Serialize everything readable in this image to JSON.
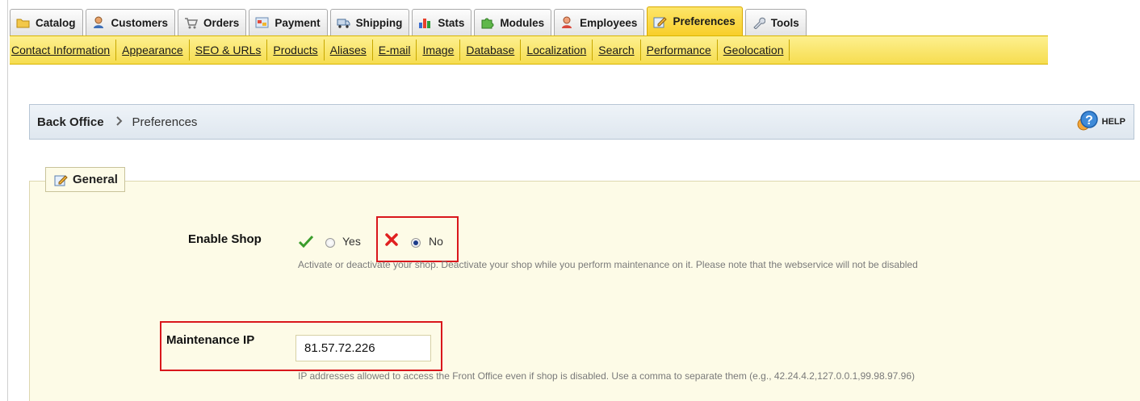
{
  "tabs": [
    {
      "label": "Catalog",
      "icon": "folder-icon"
    },
    {
      "label": "Customers",
      "icon": "customer-icon"
    },
    {
      "label": "Orders",
      "icon": "cart-icon"
    },
    {
      "label": "Payment",
      "icon": "payment-icon"
    },
    {
      "label": "Shipping",
      "icon": "truck-icon"
    },
    {
      "label": "Stats",
      "icon": "bar-chart-icon"
    },
    {
      "label": "Modules",
      "icon": "puzzle-icon"
    },
    {
      "label": "Employees",
      "icon": "employee-icon"
    },
    {
      "label": "Preferences",
      "icon": "edit-icon",
      "active": true
    },
    {
      "label": "Tools",
      "icon": "wrench-icon"
    }
  ],
  "subnav": [
    "Contact Information",
    "Appearance",
    "SEO & URLs",
    "Products",
    "Aliases",
    "E-mail",
    "Image",
    "Database",
    "Localization",
    "Search",
    "Performance",
    "Geolocation"
  ],
  "breadcrumb": {
    "first": "Back Office",
    "second": "Preferences",
    "help": "HELP"
  },
  "fieldset": {
    "legend": "General"
  },
  "enable_shop": {
    "label": "Enable Shop",
    "yes": "Yes",
    "no": "No",
    "selected": "No",
    "hint": "Activate or deactivate your shop. Deactivate your shop while you perform maintenance on it. Please note that the webservice will not be disabled"
  },
  "maintenance_ip": {
    "label": "Maintenance IP",
    "value": "81.57.72.226",
    "hint": "IP addresses allowed to access the Front Office even if shop is disabled. Use a comma to separate them (e.g., 42.24.4.2,127.0.0.1,99.98.97.96)"
  },
  "colors": {
    "active_tab": "#f8ce2a",
    "subnav_bg": "#f6dd50",
    "highlight": "#d9171c",
    "fieldset_bg": "#fdfbe7"
  }
}
